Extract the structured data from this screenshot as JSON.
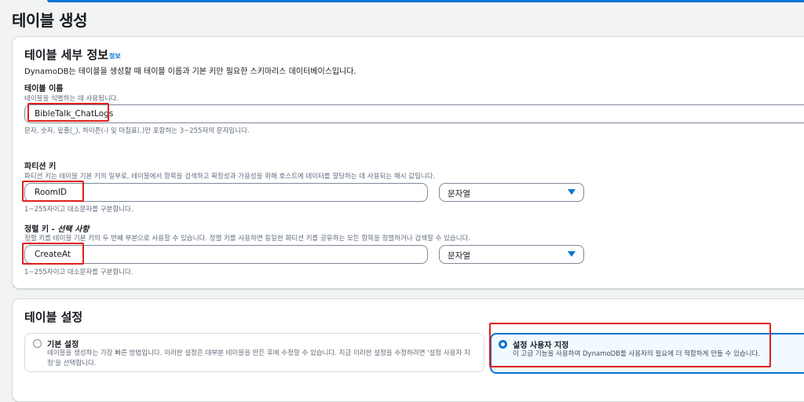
{
  "page": {
    "title": "테이블 생성"
  },
  "details": {
    "heading": "테이블 세부 정보",
    "info_link": "정보",
    "description": "DynamoDB는 테이블을 생성할 때 테이블 이름과 기본 키만 필요한 스키마리스 데이터베이스입니다.",
    "table_name": {
      "label": "테이블 이름",
      "sublabel": "테이블을 식별하는 데 사용됩니다.",
      "value": "BibleTalk_ChatLogs",
      "hint": "문자, 숫자, 밑줄(_), 하이픈(-) 및 마침표(.)만 포함하는 3~255자의 문자입니다."
    },
    "partition_key": {
      "label": "파티션 키",
      "sublabel": "파티션 키는 테이블 기본 키의 일부로, 테이블에서 항목을 검색하고 확장성과 가용성을 위해 호스트에 데이터를 할당하는 데 사용되는 해시 값입니다.",
      "value": "RoomID",
      "type": "문자열",
      "hint": "1~255자이고 대소문자를 구분합니다."
    },
    "sort_key": {
      "label": "정렬 키 - ",
      "label_optional": "선택 사항",
      "sublabel": "정렬 키를 테이블 기본 키의 두 번째 부분으로 사용할 수 있습니다. 정렬 키를 사용하면 동일한 파티션 키를 공유하는 모든 항목을 정렬하거나 검색할 수 있습니다.",
      "value": "CreateAt",
      "type": "문자열",
      "hint": "1~255자이고 대소문자를 구분합니다."
    }
  },
  "settings": {
    "heading": "테이블 설정",
    "default_option": {
      "title": "기본 설정",
      "description": "테이블을 생성하는 가장 빠른 방법입니다. 이러한 설정은 대부분 테이블을 만든 후에 수정할 수 있습니다. 지금 이러한 설정을 수정하려면 '설정 사용자 지정'을 선택합니다."
    },
    "custom_option": {
      "title": "설정 사용자 지정",
      "description": "이 고급 기능을 사용하여 DynamoDB를 사용자의 필요에 더 적합하게 만들 수 있습니다."
    }
  },
  "colors": {
    "accent": "#0972d3",
    "highlight": "#e0201c"
  }
}
